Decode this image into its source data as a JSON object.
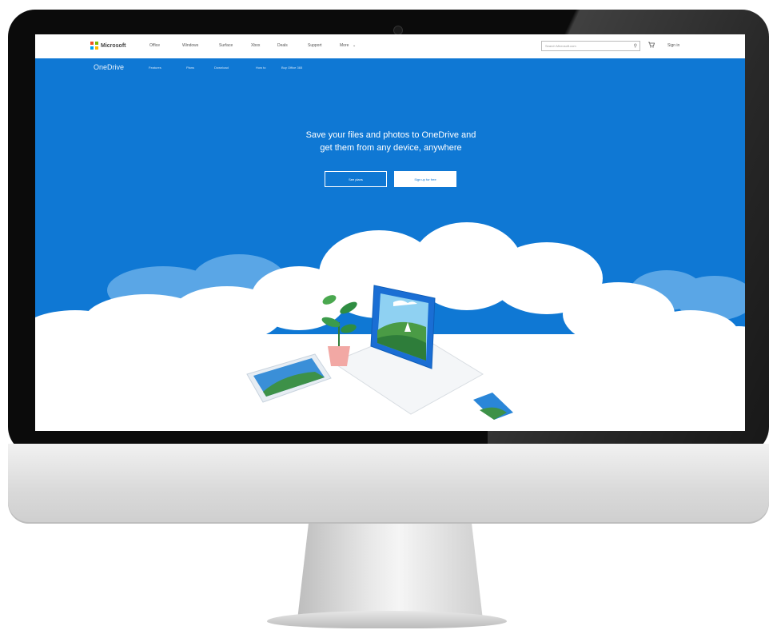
{
  "brand_colors": {
    "accent": "#0f78d4",
    "ms_red": "#f25022",
    "ms_green": "#7fba00",
    "ms_blue": "#00a4ef",
    "ms_yellow": "#ffb900"
  },
  "topbar": {
    "logo_text": "Microsoft",
    "nav": [
      "Office",
      "Windows",
      "Surface",
      "Xbox",
      "Deals",
      "Support",
      "More"
    ],
    "search_placeholder": "Search Microsoft.com",
    "cart_icon": "cart-icon",
    "signin": "Sign in"
  },
  "subnav": {
    "brand": "OneDrive",
    "items": [
      "Features",
      "Plans",
      "Download",
      "How to",
      "Buy Office 365"
    ]
  },
  "hero": {
    "headline_line1": "Save your files and photos to OneDrive and",
    "headline_line2": "get them from any device, anywhere",
    "buttons": {
      "see_plans": "See plans",
      "sign_up": "Sign up for free"
    }
  },
  "icons": [
    "microsoft-logo-icon",
    "search-icon",
    "cart-icon",
    "camera-icon"
  ]
}
